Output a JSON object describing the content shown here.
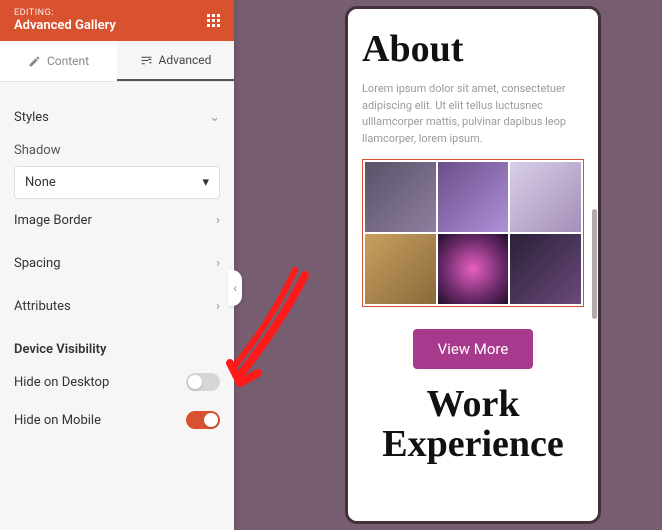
{
  "header": {
    "editing_label": "EDITING:",
    "block_name": "Advanced Gallery"
  },
  "tabs": {
    "content": "Content",
    "advanced": "Advanced"
  },
  "styles": {
    "heading": "Styles",
    "shadow_label": "Shadow",
    "shadow_value": "None"
  },
  "sections": {
    "image_border": "Image Border",
    "spacing": "Spacing",
    "attributes": "Attributes"
  },
  "visibility": {
    "heading": "Device Visibility",
    "hide_desktop": "Hide on Desktop",
    "hide_mobile": "Hide on Mobile",
    "hide_desktop_on": false,
    "hide_mobile_on": true
  },
  "preview": {
    "about_heading": "About",
    "about_text": "Lorem ipsum dolor sit amet, consectetuer adipiscing elit. Ut elit tellus luctusnec ulllamcorper mattis, pulvinar dapibus leop llamcorper, lorem ipsum.",
    "button": "View More",
    "work_heading": "Work Experience"
  }
}
